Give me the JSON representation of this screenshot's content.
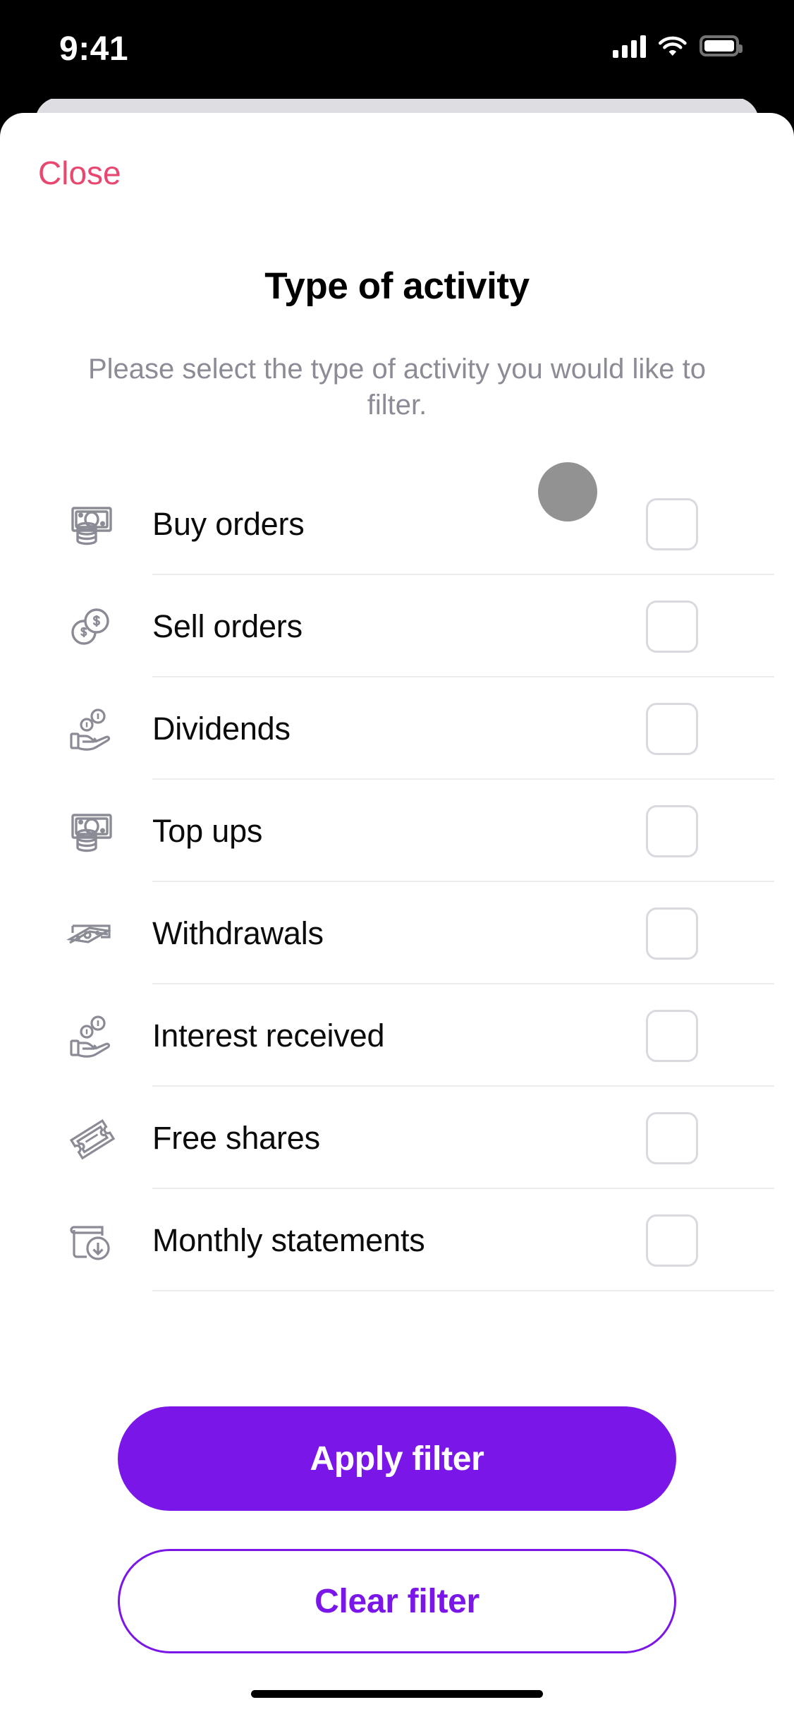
{
  "status_bar": {
    "time": "9:41",
    "icons": [
      "cellular-signal-icon",
      "wifi-icon",
      "battery-icon"
    ]
  },
  "sheet": {
    "close_label": "Close",
    "title": "Type of activity",
    "subtitle": "Please select the type of activity you would like to filter."
  },
  "activity_list": [
    {
      "label": "Buy orders",
      "icon": "banknote-coins-icon",
      "checked": false
    },
    {
      "label": "Sell orders",
      "icon": "two-coins-dollar-icon",
      "checked": false
    },
    {
      "label": "Dividends",
      "icon": "hand-coins-icon",
      "checked": false
    },
    {
      "label": "Top ups",
      "icon": "banknote-coins-icon",
      "checked": false
    },
    {
      "label": "Withdrawals",
      "icon": "banknotes-out-icon",
      "checked": false
    },
    {
      "label": "Interest received",
      "icon": "hand-coins-icon",
      "checked": false
    },
    {
      "label": "Free shares",
      "icon": "ticket-icon",
      "checked": false
    },
    {
      "label": "Monthly statements",
      "icon": "book-download-icon",
      "checked": false
    }
  ],
  "footer": {
    "apply_label": "Apply filter",
    "clear_label": "Clear filter"
  },
  "colors": {
    "close_pink": "#e8476f",
    "accent_purple": "#7a17e8",
    "icon_gray": "#8b8b96",
    "subtitle_gray": "#8c8c96",
    "cursor_gray": "#929292",
    "divider": "#ececef",
    "checkbox_border": "#d9d9e0",
    "sheet_back": "#dedee2"
  }
}
